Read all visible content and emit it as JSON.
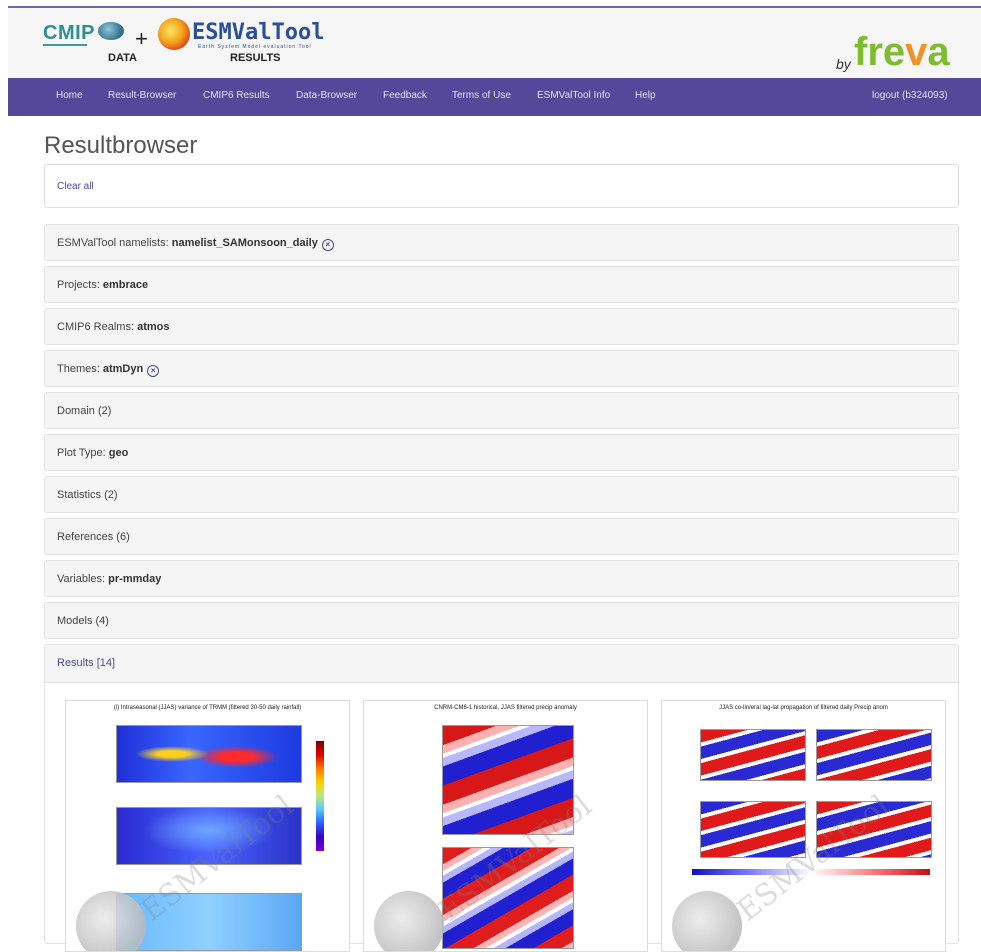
{
  "header": {
    "cmip_logo": "CMIP",
    "data_label": "DATA",
    "plus": "+",
    "esmvaltool_logo": "ESMValTool",
    "esmvaltool_tagline": "Earth System Model evaluation Tool",
    "results_label": "RESULTS",
    "by": "by",
    "freva_logo_prefix": "fre",
    "freva_logo_v": "v",
    "freva_logo_suffix": "a"
  },
  "nav": {
    "items": [
      "Home",
      "Result-Browser",
      "CMIP6 Results",
      "Data-Browser",
      "Feedback",
      "Terms of Use",
      "ESMValTool Info",
      "Help"
    ],
    "logout": "logout (b324093)"
  },
  "page": {
    "title": "Resultbrowser",
    "clear_all": "Clear all"
  },
  "facets": [
    {
      "label": "ESMValTool namelists:",
      "value": "namelist_SAMonsoon_daily",
      "removable": true
    },
    {
      "label": "Projects:",
      "value": "embrace",
      "removable": false
    },
    {
      "label": "CMIP6 Realms:",
      "value": "atmos",
      "removable": false
    },
    {
      "label": "Themes:",
      "value": "atmDyn",
      "removable": true
    },
    {
      "label": "Domain (2)",
      "value": "",
      "removable": false
    },
    {
      "label": "Plot Type:",
      "value": "geo",
      "removable": false
    },
    {
      "label": "Statistics (2)",
      "value": "",
      "removable": false
    },
    {
      "label": "References (6)",
      "value": "",
      "removable": false
    },
    {
      "label": "Variables:",
      "value": "pr-mmday",
      "removable": false
    },
    {
      "label": "Models (4)",
      "value": "",
      "removable": false
    }
  ],
  "results": {
    "title": "Results [14]",
    "thumbnails": [
      {
        "title": "(i) Intraseasonal (JJAS) variance of TRMM (filtered 30-50 daily rainfall)",
        "watermark": "ESMValTool"
      },
      {
        "title": "CNRM-CM6-1 historical, JJAS filtered precip anomaly",
        "watermark": "ESMValTool"
      },
      {
        "title": "JJAS co-lin/eral lag-lat propagation of filtered daily Precip anom",
        "watermark": "ESMValTool"
      }
    ]
  },
  "colors": {
    "navbar": "#55479a",
    "link": "#4a4aa0",
    "freva_green": "#7dbb2f",
    "freva_orange": "#f29225"
  }
}
